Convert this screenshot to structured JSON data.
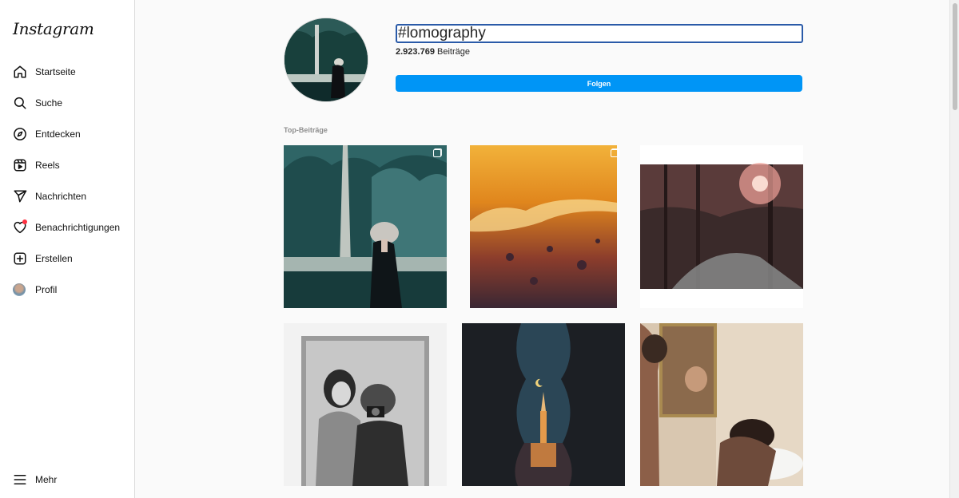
{
  "app": {
    "logo_text": "Instagram"
  },
  "sidebar": {
    "items": [
      {
        "label": "Startseite",
        "icon": "home-icon"
      },
      {
        "label": "Suche",
        "icon": "search-icon"
      },
      {
        "label": "Entdecken",
        "icon": "compass-icon"
      },
      {
        "label": "Reels",
        "icon": "reels-icon"
      },
      {
        "label": "Nachrichten",
        "icon": "paper-plane-icon"
      },
      {
        "label": "Benachrichtigungen",
        "icon": "heart-icon"
      },
      {
        "label": "Erstellen",
        "icon": "plus-square-icon"
      },
      {
        "label": "Profil",
        "icon": "avatar"
      }
    ],
    "more": {
      "label": "Mehr",
      "icon": "hamburger-menu-icon"
    }
  },
  "hashtag": {
    "name": "#lomography",
    "post_count_value": "2.923.769",
    "post_count_label": "Beiträge",
    "follow_label": "Folgen"
  },
  "top_posts": {
    "label": "Top-Beiträge",
    "tiles": [
      {
        "subject": "forest lake woman in fur hat",
        "multi": true
      },
      {
        "subject": "orange sunset beach waves",
        "multi": true
      },
      {
        "subject": "forest path with light leaks",
        "multi": false
      },
      {
        "subject": "black and white couple mirror selfie",
        "multi": false
      },
      {
        "subject": "empire state building between balconies",
        "multi": false
      },
      {
        "subject": "bathroom mirror self portrait",
        "multi": false
      }
    ]
  },
  "colors": {
    "accent": "#0095f6",
    "notification_dot": "#ff3040",
    "input_border": "#2a5aa8"
  }
}
